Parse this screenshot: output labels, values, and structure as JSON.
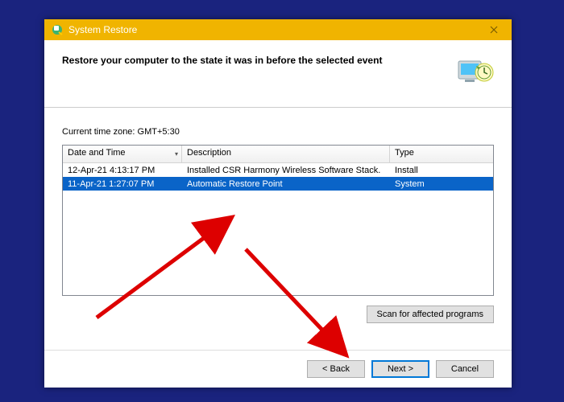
{
  "titlebar": {
    "title": "System Restore"
  },
  "header": {
    "heading": "Restore your computer to the state it was in before the selected event"
  },
  "body": {
    "timezone_label": "Current time zone: GMT+5:30",
    "columns": {
      "c0": "Date and Time",
      "c1": "Description",
      "c2": "Type"
    },
    "rows": [
      {
        "date": "12-Apr-21 4:13:17 PM",
        "desc": "Installed CSR Harmony Wireless Software Stack.",
        "type": "Install",
        "selected": false
      },
      {
        "date": "11-Apr-21 1:27:07 PM",
        "desc": "Automatic Restore Point",
        "type": "System",
        "selected": true
      }
    ],
    "scan_button": "Scan for affected programs"
  },
  "footer": {
    "back": "< Back",
    "next": "Next >",
    "cancel": "Cancel"
  }
}
